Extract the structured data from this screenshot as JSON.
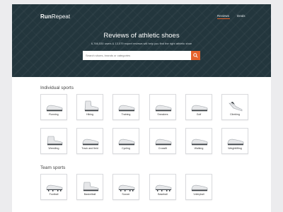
{
  "brand": {
    "logo_bold": "Run",
    "logo_light": "Repeat"
  },
  "nav": {
    "reviews": "Reviews",
    "deals": "Deals"
  },
  "hero": {
    "title": "Reviews of athletic shoes",
    "subtitle": "6,766,530 users & 13,579 expert reviews will help you find the right athletic shoe"
  },
  "search": {
    "placeholder": "Search shoes, brands or categories"
  },
  "sections": {
    "individual": "Individual sports",
    "team": "Team sports"
  },
  "individual_sports": [
    "Running",
    "Hiking",
    "Training",
    "Sneakers",
    "Golf",
    "Climbing",
    "Wrestling",
    "Track and field",
    "Cycling",
    "Crossfit",
    "Walking",
    "Weightlifting"
  ],
  "team_sports": [
    "Football",
    "Basketball",
    "Soccer",
    "Baseball",
    "Volleyball"
  ],
  "colors": {
    "hero_bg": "#23363d",
    "accent": "#e5622b"
  },
  "icons": {
    "search": "search-icon",
    "shoe": "shoe-icon"
  }
}
